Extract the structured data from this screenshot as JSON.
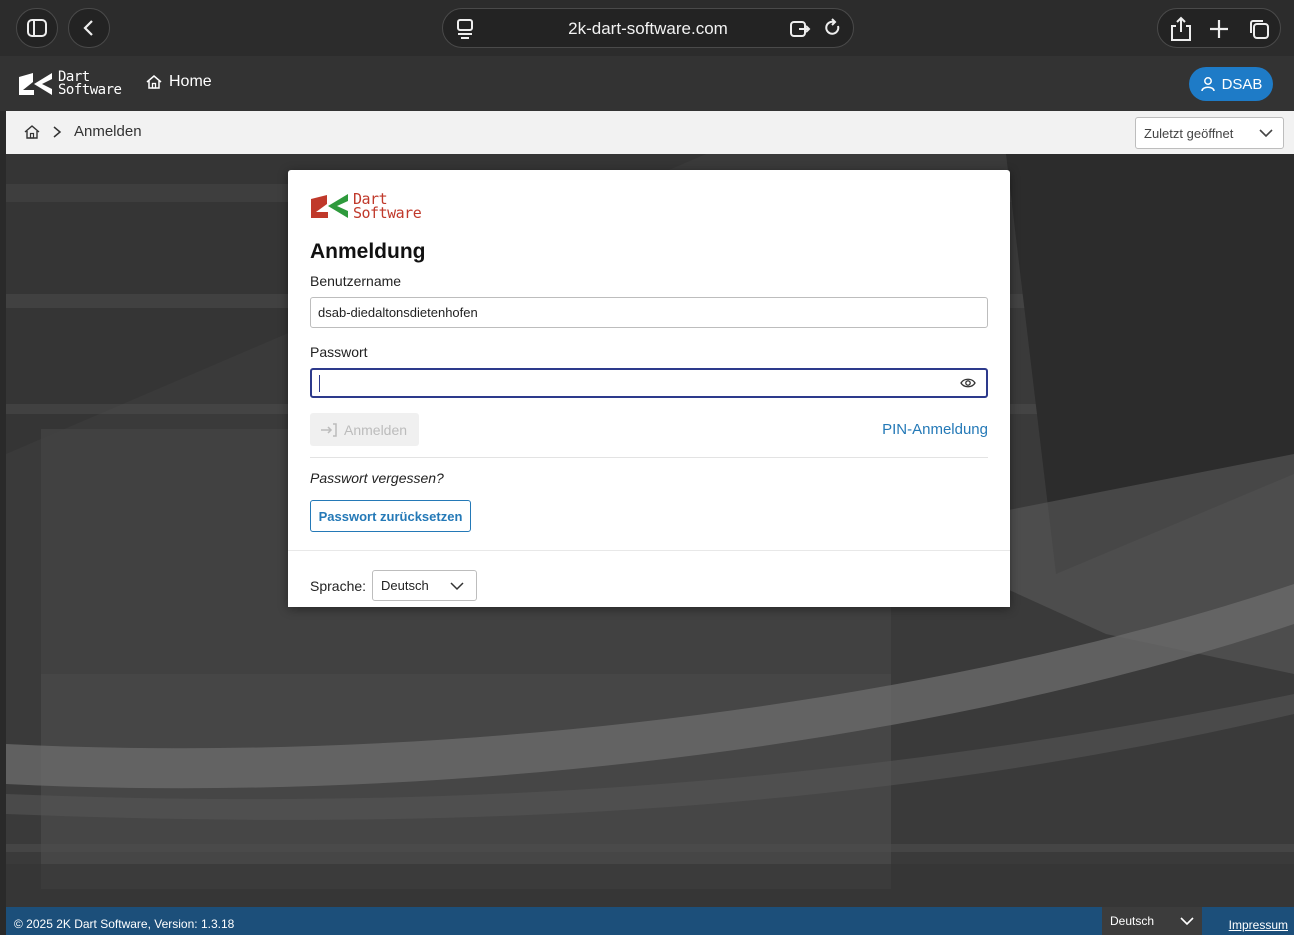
{
  "browser": {
    "url": "2k-dart-software.com"
  },
  "appbar": {
    "logo_line1": "Dart",
    "logo_line2": "Software",
    "home_label": "Home",
    "user_button": "DSAB"
  },
  "breadcrumb": {
    "current": "Anmelden",
    "recent_select": "Zuletzt geöffnet"
  },
  "login": {
    "logo_line1": "Dart",
    "logo_line2": "Software",
    "title": "Anmeldung",
    "username_label": "Benutzername",
    "username_value": "dsab-diedaltonsdietenhofen",
    "password_label": "Passwort",
    "password_value": "",
    "submit_label": "Anmelden",
    "pin_link": "PIN-Anmeldung",
    "forgot_text": "Passwort vergessen?",
    "reset_button": "Passwort zurücksetzen",
    "language_label": "Sprache:",
    "language_value": "Deutsch"
  },
  "footer": {
    "copyright": "© 2025 2K Dart Software, Version: 1.3.18",
    "language": "Deutsch",
    "impressum": "Impressum"
  },
  "colors": {
    "accent": "#1e7bc7",
    "link": "#2479b7",
    "footer": "#1c4f7a",
    "logo_red": "#c0392b",
    "logo_green": "#2e9a3c"
  }
}
